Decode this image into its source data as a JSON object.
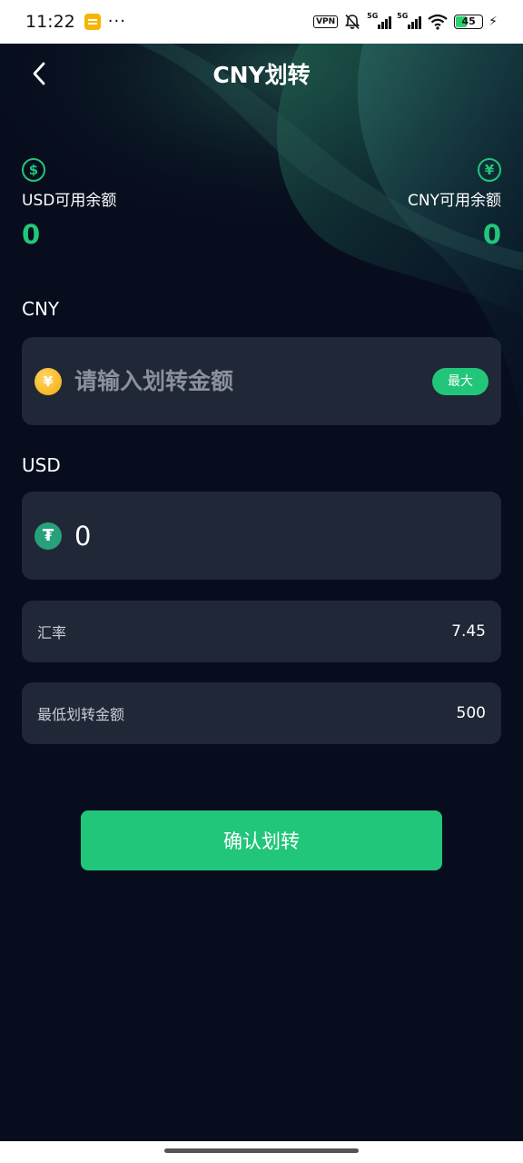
{
  "status_bar": {
    "time": "11:22",
    "dots": "···",
    "vpn": "VPN",
    "network1": "5G",
    "network2": "5G",
    "battery": "45",
    "icons": [
      "note-icon",
      "mute-icon",
      "signal-icon",
      "wifi-icon",
      "battery-icon",
      "charging-icon"
    ]
  },
  "header": {
    "title": "CNY划转",
    "back_icon": "chevron-left-icon"
  },
  "balances": {
    "usd": {
      "icon": "$",
      "label": "USD可用余额",
      "value": "0"
    },
    "cny": {
      "icon": "¥",
      "label": "CNY可用余额",
      "value": "0"
    }
  },
  "cny_section": {
    "label": "CNY",
    "coin_icon": "¥",
    "input_placeholder": "请输入划转金额",
    "max_label": "最大"
  },
  "usd_section": {
    "label": "USD",
    "coin_icon": "₮",
    "value": "0"
  },
  "info": {
    "rate_label": "汇率",
    "rate_value": "7.45",
    "min_label": "最低划转金额",
    "min_value": "500"
  },
  "confirm_label": "确认划转",
  "colors": {
    "background": "#070d1d",
    "card": "#202737",
    "accent": "#22c67a"
  }
}
